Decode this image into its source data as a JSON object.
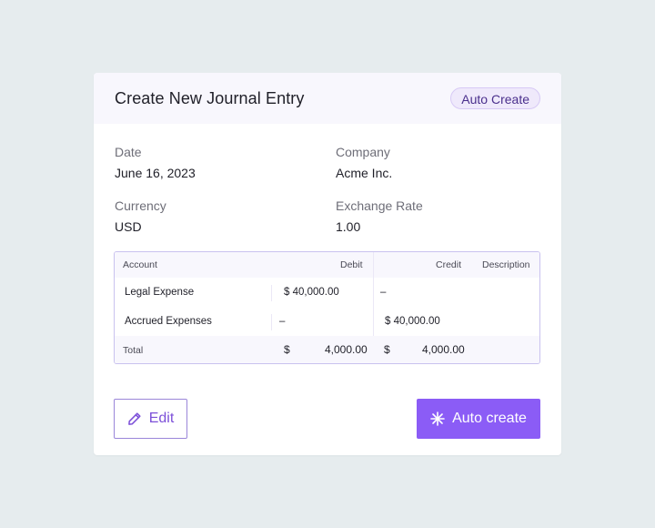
{
  "header": {
    "title": "Create New Journal Entry",
    "badge": "Auto Create"
  },
  "fields": {
    "date": {
      "label": "Date",
      "value": "June 16, 2023"
    },
    "company": {
      "label": "Company",
      "value": "Acme Inc."
    },
    "currency": {
      "label": "Currency",
      "value": "USD"
    },
    "exchange_rate": {
      "label": "Exchange Rate",
      "value": "1.00"
    }
  },
  "table": {
    "columns": [
      "Account",
      "Debit",
      "Credit",
      "Description"
    ],
    "rows": [
      {
        "account": "Legal Expense",
        "debit": "$ 40,000.00",
        "credit": "–",
        "description": ""
      },
      {
        "account": "Accrued Expenses",
        "debit": "–",
        "credit": "$ 40,000.00",
        "description": ""
      }
    ],
    "total": {
      "label": "Total",
      "debit_currency": "$",
      "debit": "4,000.00",
      "credit_currency": "$",
      "credit": "4,000.00"
    }
  },
  "actions": {
    "edit_label": "Edit",
    "auto_create_label": "Auto create"
  },
  "icons": {
    "edit": "pencil-icon",
    "auto_create": "sparkle-icon"
  },
  "colors": {
    "accent": "#8b5cf6",
    "accent_text": "#7c4fd8",
    "badge_bg": "#efe9fb",
    "page_bg": "#e6ecee"
  }
}
